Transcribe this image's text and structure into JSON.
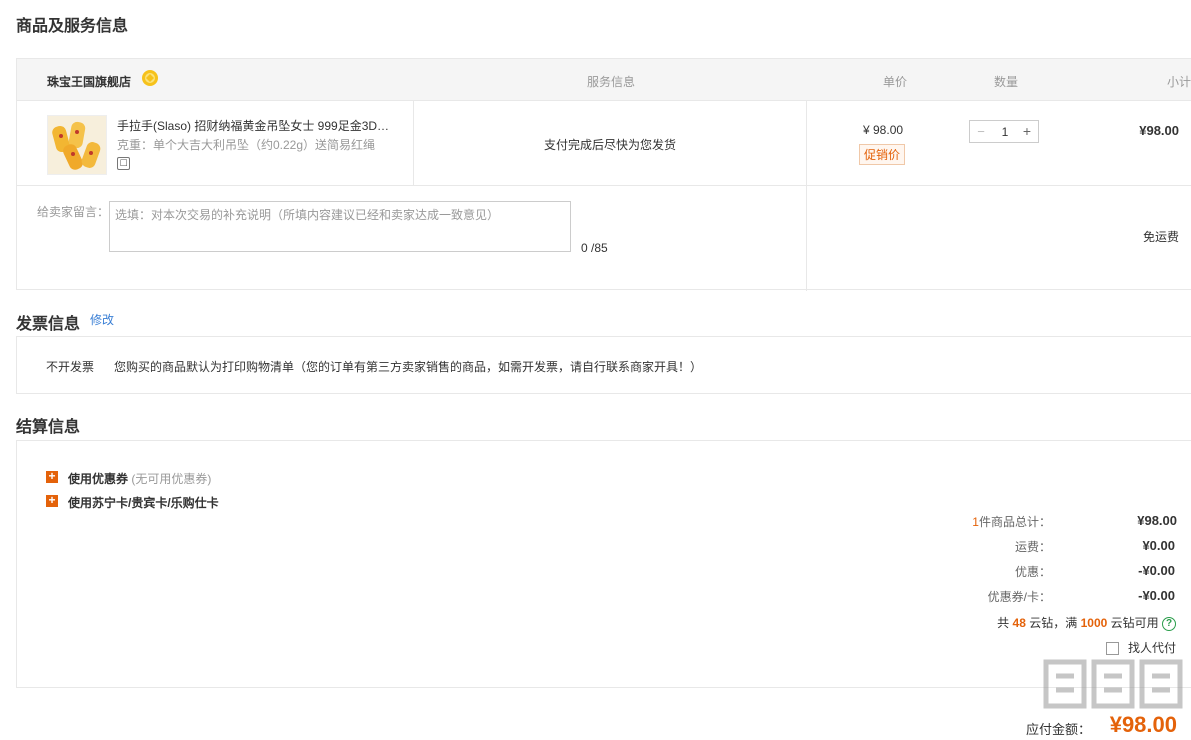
{
  "sections": {
    "goods_title": "商品及服务信息",
    "invoice_title": "发票信息",
    "invoice_edit": "修改",
    "settle_title": "结算信息"
  },
  "order": {
    "store_name": "珠宝王国旗舰店",
    "store_badge_icon": "gold-medal-icon",
    "columns": {
      "service": "服务信息",
      "price": "单价",
      "qty": "数量",
      "subtotal": "小计"
    },
    "product": {
      "title": "手拉手(Slaso) 招财纳福黄金吊坠女士 999足金3D…",
      "spec": "克重：单个大吉大利吊坠（约0.22g）送简易红绳",
      "spec_icon": "picture-icon",
      "service": "支付完成后尽快为您发货",
      "price": "¥ 98.00",
      "promo_tag": "促销价",
      "qty": "1",
      "minus": "−",
      "plus": "+",
      "subtotal": "¥98.00"
    },
    "message": {
      "label": "给卖家留言：",
      "placeholder": "选填：对本次交易的补充说明（所填内容建议已经和卖家达成一致意见）",
      "count": "0 /85"
    },
    "shipping": "免运费"
  },
  "invoice": {
    "type": "不开发票",
    "desc": "您购买的商品默认为打印购物清单（您的订单有第三方卖家销售的商品，如需开发票，请自行联系商家开具！）"
  },
  "settlement": {
    "coupon_label": "使用优惠券",
    "coupon_note": "(无可用优惠券)",
    "card_label": "使用苏宁卡/贵宾卡/乐购仕卡",
    "summary": {
      "count_num": "1",
      "count_label": "件商品总计：",
      "total_goods": "¥98.00",
      "freight_label": "运费：",
      "freight": "¥0.00",
      "discount_label": "优惠：",
      "discount": "-¥0.00",
      "coupon_card_label": "优惠券/卡：",
      "coupon_card": "-¥0.00"
    },
    "coins": {
      "pre": "共",
      "count": "48",
      "mid": "云钻，满",
      "threshold": "1000",
      "post": "云钻可用"
    },
    "proxy_pay": "找人代付",
    "payable_label": "应付金额：",
    "payable": "¥98.00"
  },
  "watermark": "值值值",
  "colors": {
    "accent": "#e4620a",
    "link": "#3a7fd5",
    "help": "#2a9d4b"
  }
}
